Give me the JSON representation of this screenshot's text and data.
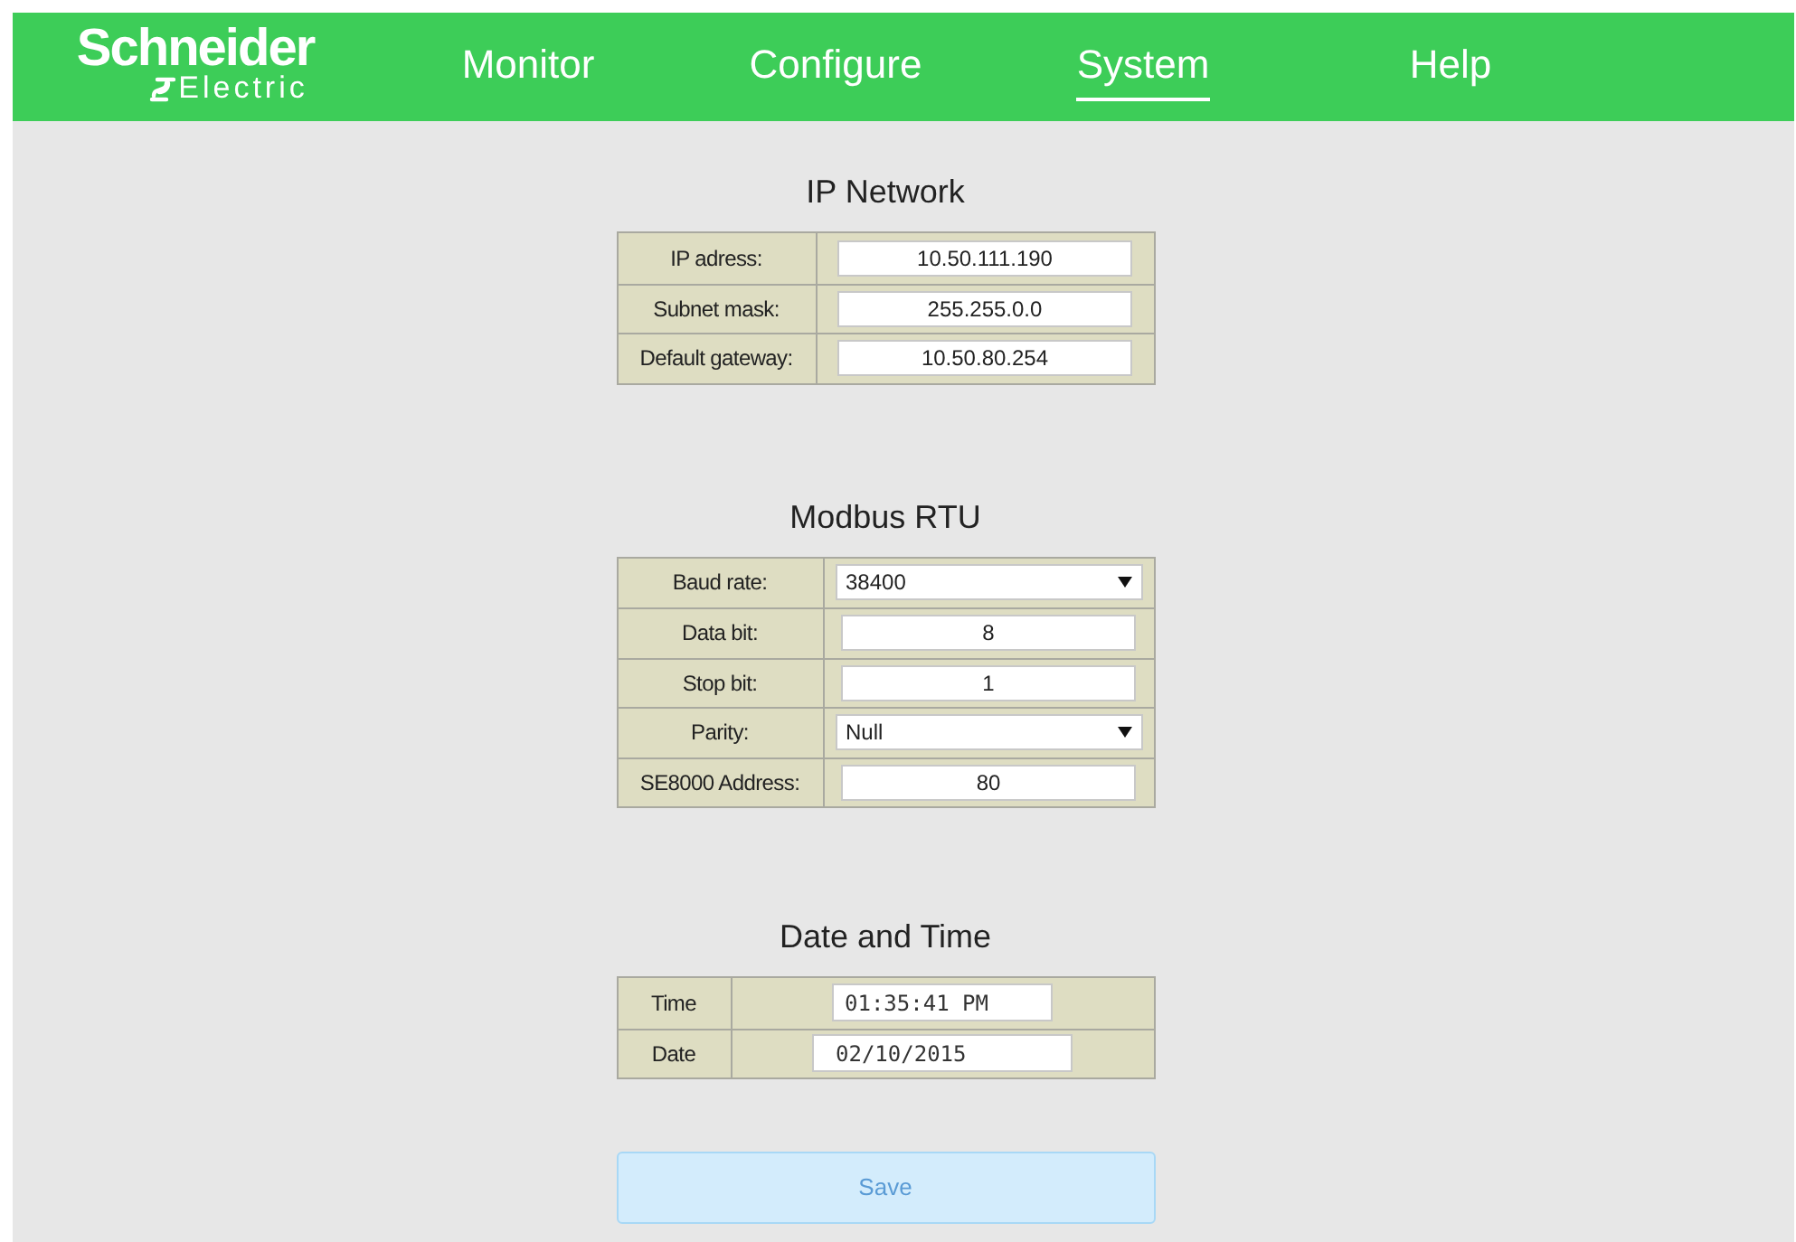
{
  "logo": {
    "name": "Schneider",
    "subtitle": "Electric"
  },
  "nav": [
    {
      "label": "Monitor",
      "selected": false
    },
    {
      "label": "Configure",
      "selected": false
    },
    {
      "label": "System",
      "selected": true
    },
    {
      "label": "Help",
      "selected": false
    }
  ],
  "sections": [
    {
      "title": "IP Network",
      "rows": [
        {
          "label": "IP adress:",
          "kind": "text",
          "value": "10.50.111.190"
        },
        {
          "label": "Subnet mask:",
          "kind": "text",
          "value": "255.255.0.0"
        },
        {
          "label": "Default gateway:",
          "kind": "text",
          "value": "10.50.80.254"
        }
      ]
    },
    {
      "title": "Modbus RTU",
      "rows": [
        {
          "label": "Baud rate:",
          "kind": "select",
          "value": "38400"
        },
        {
          "label": "Data bit:",
          "kind": "text",
          "value": "8"
        },
        {
          "label": "Stop bit:",
          "kind": "text",
          "value": "1"
        },
        {
          "label": "Parity:",
          "kind": "select",
          "value": "Null"
        },
        {
          "label": "SE8000 Address:",
          "kind": "text",
          "value": "80"
        }
      ]
    },
    {
      "title": "Date and Time",
      "rows": [
        {
          "label": "Time",
          "kind": "time",
          "value": "01:35:41 PM"
        },
        {
          "label": "Date",
          "kind": "date",
          "value": "02/10/2015"
        }
      ]
    }
  ],
  "save_button": "Save"
}
